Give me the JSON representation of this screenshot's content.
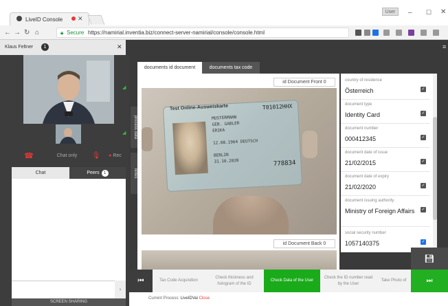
{
  "browser": {
    "tab_title": "LiveID Console",
    "secure_label": "Secure",
    "url": "https://namirial.inventia.biz/connect-server-namirial/console/console.html",
    "window_user": "User"
  },
  "agent": {
    "name": "Klaus Feltner",
    "badge": "1"
  },
  "controls": {
    "chat_only": "Chat only",
    "rec": "Rec"
  },
  "chat": {
    "tab_chat": "Chat",
    "tab_peers": "Peers",
    "peers_count": "1",
    "screen_sharing": "SCREEN SHARING"
  },
  "side_tabs": {
    "process_data": "process data",
    "notes": "notes"
  },
  "documents": {
    "tab_id": "documents id document",
    "tab_tax": "documents tax code",
    "front_label": "id Document Front 0",
    "back_label": "id Document Back 0",
    "card_header": "Test Online-Ausweiskarte",
    "card_number": "T01012HHX",
    "card_lines": [
      "MUSTERMANN",
      "GEB. GABLER",
      "ERIKA",
      "",
      "12.08.1964  DEUTSCH",
      "",
      "BERLIN",
      "31.10.2020"
    ],
    "card_can": "778834"
  },
  "fields": [
    {
      "label": "country of residence",
      "value": "Österreich"
    },
    {
      "label": "document type",
      "value": "Identity Card"
    },
    {
      "label": "document number",
      "value": "000412345"
    },
    {
      "label": "document date of issue",
      "value": "21/02/2015"
    },
    {
      "label": "document date of expiry",
      "value": "21/02/2020"
    },
    {
      "label": "document issuing authority",
      "value": "Ministry of Foreign Affairs"
    },
    {
      "label": "social security number",
      "value": "1057140375"
    }
  ],
  "steps": [
    {
      "label": "Tax Code Acquisition"
    },
    {
      "label": "Check thickness and hologram of the ID"
    },
    {
      "label": "Check Data of the User"
    },
    {
      "label": "Check the ID number read by the User"
    },
    {
      "label": "Take Photo of"
    }
  ],
  "process": {
    "label": "Current Process:",
    "name": "LiveIDVai",
    "close": "Close"
  },
  "colors": {
    "accent_green": "#1aab1a",
    "dark_bg": "#3a3a3a",
    "hangup_red": "#e53935"
  }
}
